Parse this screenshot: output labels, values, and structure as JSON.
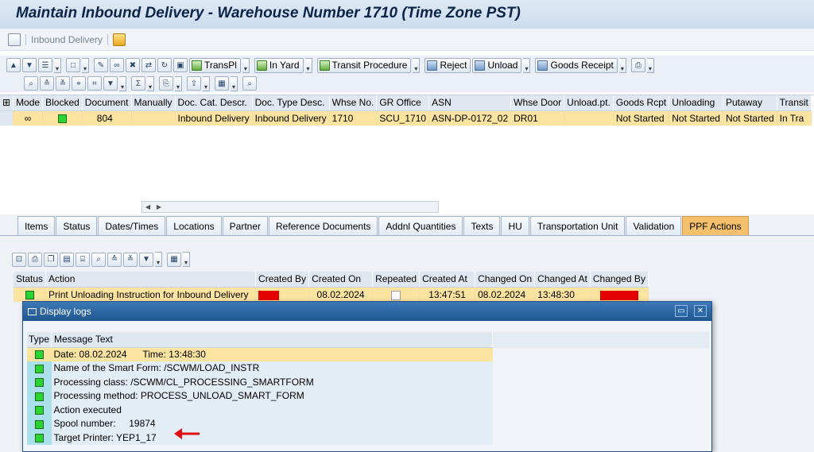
{
  "title": "Maintain Inbound Delivery - Warehouse Number 1710 (Time Zone PST)",
  "appbar": {
    "menu_label": "Inbound Delivery"
  },
  "toolbar": {
    "transpl": "TransPl",
    "in_yard": "In Yard",
    "transit_procedure": "Transit Procedure",
    "reject": "Reject",
    "unload": "Unload",
    "goods_receipt": "Goods Receipt"
  },
  "grid": {
    "columns": [
      "Mode",
      "Blocked",
      "Document",
      "Manually",
      "Doc. Cat. Descr.",
      "Doc. Type Desc.",
      "Whse No.",
      "GR Office",
      "ASN",
      "Whse Door",
      "Unload.pt.",
      "Goods Rcpt",
      "Unloading",
      "Putaway",
      "Transit"
    ],
    "row": {
      "document": "804",
      "doc_cat": "Inbound Delivery",
      "doc_type": "Inbound Delivery",
      "whse_no": "1710",
      "gr_office": "SCU_1710",
      "asn": "ASN-DP-0172_02",
      "whse_door": "DR01",
      "goods_rcpt": "Not Started",
      "unloading": "Not Started",
      "putaway": "Not Started",
      "transit": "In Tra"
    }
  },
  "tabs": [
    "Items",
    "Status",
    "Dates/Times",
    "Locations",
    "Partner",
    "Reference Documents",
    "Addnl Quantities",
    "Texts",
    "HU",
    "Transportation Unit",
    "Validation",
    "PPF Actions"
  ],
  "actions": {
    "columns": [
      "Status",
      "Action",
      "Created By",
      "Created On",
      "Repeated",
      "Created At",
      "Changed On",
      "Changed At",
      "Changed By"
    ],
    "row": {
      "action": "Print Unloading Instruction for Inbound Delivery",
      "created_on": "08.02.2024",
      "created_at": "13:47:51",
      "changed_on": "08.02.2024",
      "changed_at": "13:48:30"
    }
  },
  "dialog": {
    "title": "Display logs",
    "columns": [
      "Type",
      "Message Text"
    ],
    "messages": [
      "Date: 08.02.2024      Time: 13:48:30",
      "Name of the Smart Form: /SCWM/LOAD_INSTR",
      "Processing class: /SCWM/CL_PROCESSING_SMARTFORM",
      "Processing method: PROCESS_UNLOAD_SMART_FORM",
      "Action executed",
      "Spool number:     19874",
      "Target Printer: YEP1_17"
    ]
  },
  "colors": {
    "highlight": "#fbe3a0",
    "active_tab": "#f5c06b",
    "led_green": "#2bd430",
    "redacted": "#e50000",
    "dialog_title": "#1f5690"
  }
}
